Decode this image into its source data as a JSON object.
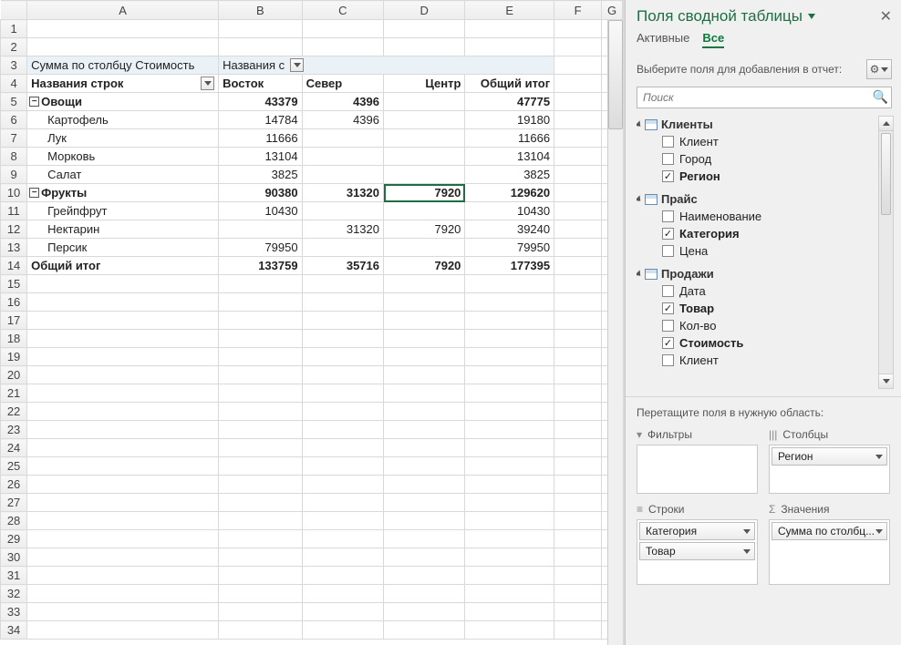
{
  "columns": [
    "A",
    "B",
    "C",
    "D",
    "E",
    "F",
    "G"
  ],
  "pivot": {
    "measure_label": "Сумма по столбцу Стоимость",
    "col_dim_label": "Названия с",
    "row_dim_label": "Названия строк",
    "col_headers": [
      "Восток",
      "Север",
      "Центр",
      "Общий итог"
    ],
    "categories": [
      {
        "name": "Овощи",
        "totals": [
          "43379",
          "4396",
          "",
          "47775"
        ],
        "items": [
          {
            "name": "Картофель",
            "vals": [
              "14784",
              "4396",
              "",
              "19180"
            ]
          },
          {
            "name": "Лук",
            "vals": [
              "11666",
              "",
              "",
              "11666"
            ]
          },
          {
            "name": "Морковь",
            "vals": [
              "13104",
              "",
              "",
              "13104"
            ]
          },
          {
            "name": "Салат",
            "vals": [
              "3825",
              "",
              "",
              "3825"
            ]
          }
        ]
      },
      {
        "name": "Фрукты",
        "totals": [
          "90380",
          "31320",
          "7920",
          "129620"
        ],
        "items": [
          {
            "name": "Грейпфрут",
            "vals": [
              "10430",
              "",
              "",
              "10430"
            ]
          },
          {
            "name": "Нектарин",
            "vals": [
              "",
              "31320",
              "7920",
              "39240"
            ]
          },
          {
            "name": "Персик",
            "vals": [
              "79950",
              "",
              "",
              "79950"
            ]
          }
        ]
      }
    ],
    "grand_label": "Общий итог",
    "grand_totals": [
      "133759",
      "35716",
      "7920",
      "177395"
    ]
  },
  "pane": {
    "title": "Поля сводной таблицы",
    "tabs": {
      "active": "Активные",
      "all": "Все"
    },
    "prompt": "Выберите поля для добавления в отчет:",
    "search_placeholder": "Поиск",
    "tables": [
      {
        "name": "Клиенты",
        "fields": [
          {
            "name": "Клиент",
            "checked": false
          },
          {
            "name": "Город",
            "checked": false
          },
          {
            "name": "Регион",
            "checked": true
          }
        ]
      },
      {
        "name": "Прайс",
        "fields": [
          {
            "name": "Наименование",
            "checked": false
          },
          {
            "name": "Категория",
            "checked": true
          },
          {
            "name": "Цена",
            "checked": false
          }
        ]
      },
      {
        "name": "Продажи",
        "fields": [
          {
            "name": "Дата",
            "checked": false
          },
          {
            "name": "Товар",
            "checked": true
          },
          {
            "name": "Кол-во",
            "checked": false
          },
          {
            "name": "Стоимость",
            "checked": true
          },
          {
            "name": "Клиент",
            "checked": false
          }
        ]
      }
    ],
    "drag_prompt": "Перетащите поля в нужную область:",
    "areas": {
      "filters": {
        "label": "Фильтры",
        "chips": []
      },
      "columns": {
        "label": "Столбцы",
        "chips": [
          "Регион"
        ]
      },
      "rows": {
        "label": "Строки",
        "chips": [
          "Категория",
          "Товар"
        ]
      },
      "values": {
        "label": "Значения",
        "chips": [
          "Сумма по столбц..."
        ]
      }
    },
    "icons": {
      "filter": "▼",
      "cols": "|||",
      "rows": "≡",
      "sigma": "Σ"
    }
  },
  "selected_cell_value": "7920"
}
